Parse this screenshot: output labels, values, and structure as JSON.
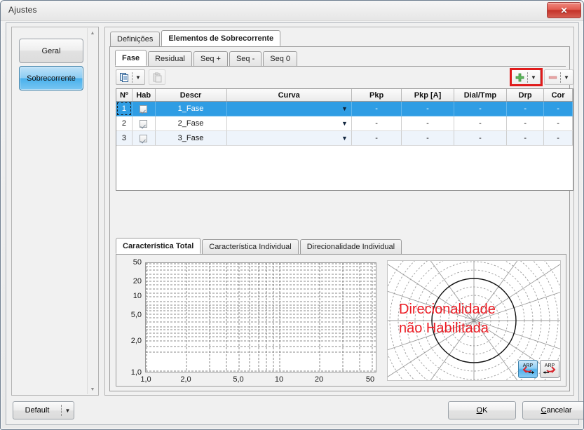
{
  "window": {
    "title": "Ajustes",
    "close_label": "✕"
  },
  "sidebar": {
    "items": [
      {
        "label": "Geral",
        "selected": false
      },
      {
        "label": "Sobrecorrente",
        "selected": true
      }
    ],
    "scroll_up_icon": "triangle-up-icon",
    "scroll_down_icon": "triangle-down-icon"
  },
  "main": {
    "outer_tabs": [
      {
        "label": "Definições",
        "selected": false
      },
      {
        "label": "Elementos de Sobrecorrente",
        "selected": true
      }
    ],
    "inner_tabs": [
      {
        "label": "Fase",
        "selected": true
      },
      {
        "label": "Residual",
        "selected": false
      },
      {
        "label": "Seq +",
        "selected": false
      },
      {
        "label": "Seq -",
        "selected": false
      },
      {
        "label": "Seq 0",
        "selected": false
      }
    ],
    "toolbar": {
      "copy_icon": "copy-icon",
      "copy_dropdown_icon": "chevron-down-icon",
      "paste_icon": "paste-icon",
      "add_icon": "plus-icon",
      "add_dropdown_icon": "chevron-down-icon",
      "remove_icon": "minus-icon",
      "remove_dropdown_icon": "chevron-down-icon",
      "highlight_color": "#e01b1b"
    },
    "table": {
      "columns": [
        "Nº",
        "Hab",
        "Descr",
        "Curva",
        "Pkp",
        "Pkp [A]",
        "Dial/Tmp",
        "Drp",
        "Cor"
      ],
      "rows": [
        {
          "num": "1",
          "hab": true,
          "descr": "1_Fase",
          "curva": "",
          "pkp": "-",
          "pkp_a": "-",
          "dial": "-",
          "drp": "-",
          "cor": "-",
          "selected": true
        },
        {
          "num": "2",
          "hab": true,
          "descr": "2_Fase",
          "curva": "",
          "pkp": "-",
          "pkp_a": "-",
          "dial": "-",
          "drp": "-",
          "cor": "-",
          "selected": false
        },
        {
          "num": "3",
          "hab": true,
          "descr": "3_Fase",
          "curva": "",
          "pkp": "-",
          "pkp_a": "-",
          "dial": "-",
          "drp": "-",
          "cor": "-",
          "selected": false
        }
      ],
      "dropdown_icon": "chevron-down-icon",
      "selection_color": "#2f9de4"
    },
    "bottom_tabs": [
      {
        "label": "Característica Total",
        "selected": true
      },
      {
        "label": "Característica Individual",
        "selected": false
      },
      {
        "label": "Direcionalidade Individual",
        "selected": false
      }
    ],
    "polar": {
      "message_line1": "Direcionalidade",
      "message_line2": "não Habilitada",
      "message_color": "#ec1c24",
      "buttons": [
        {
          "label": "ARP",
          "icon": "arrow-forward-icon",
          "selected": true
        },
        {
          "label": "ARP",
          "icon": "arrow-back-icon",
          "selected": false
        }
      ]
    }
  },
  "footer": {
    "default_label": "Default",
    "default_dropdown_icon": "chevron-down-icon",
    "ok_label": "OK",
    "ok_accel": "O",
    "cancel_label": "Cancelar",
    "cancel_accel": "C"
  },
  "chart_data": {
    "type": "line",
    "title": "Característica Total",
    "xlabel": "",
    "ylabel": "",
    "xscale": "log",
    "yscale": "log",
    "xlim": [
      1.0,
      50.0
    ],
    "ylim": [
      1.0,
      50.0
    ],
    "xticks": [
      1.0,
      2.0,
      5.0,
      10.0,
      20.0,
      50.0
    ],
    "xtick_labels": [
      "1,0",
      "2,0",
      "5,0",
      "10",
      "20",
      "50"
    ],
    "yticks": [
      1.0,
      2.0,
      5.0,
      10.0,
      20.0,
      50.0
    ],
    "ytick_labels": [
      "1,0",
      "2,0",
      "5,0",
      "10",
      "20",
      "50"
    ],
    "grid": true,
    "grid_style": "dashed",
    "series": [],
    "legend": false
  }
}
